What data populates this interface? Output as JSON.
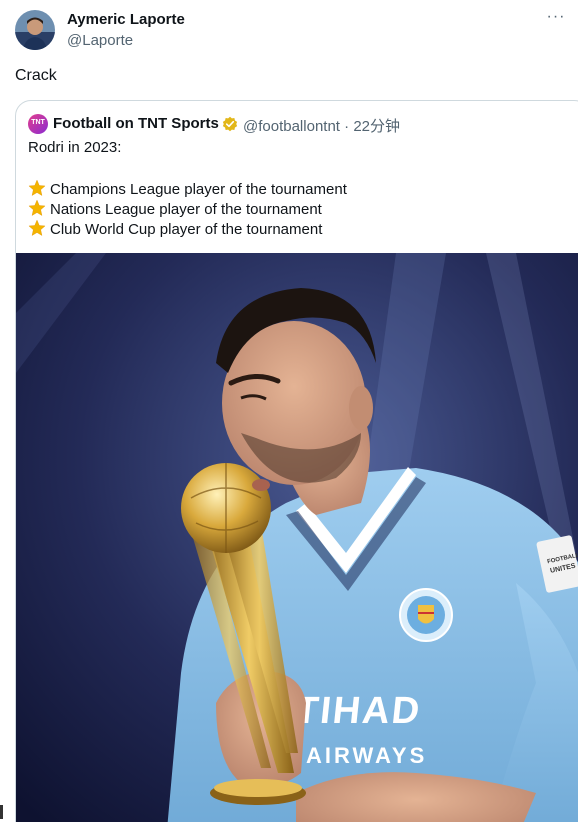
{
  "tweet": {
    "author_name": "Aymeric Laporte",
    "author_handle": "@Laporte",
    "text": "Crack",
    "more_icon": "more-horizontal-icon"
  },
  "quote": {
    "author_name": "Football on TNT Sports",
    "author_handle": "@footballontnt",
    "time_ago": "22分钟",
    "avatar_text": "TNT",
    "verified_color": "#e2b719",
    "lines": [
      "Rodri in 2023:",
      "Champions League player of the tournament",
      "Nations League player of the tournament",
      "Club World Cup player of the tournament"
    ],
    "bullet_icon": "star-icon",
    "image": {
      "subject": "player kissing golden ball trophy",
      "shirt_text_1": "ETIHAD",
      "shirt_text_2": "AIRWAYS",
      "badge_text": "MANCHESTER CITY",
      "sleeve_text": "FOOTBALL UNITES THE WORLD"
    }
  },
  "colors": {
    "text": "#0f1419",
    "secondary": "#536471",
    "border": "#cfd9de",
    "shirt": "#8fc3e8"
  }
}
